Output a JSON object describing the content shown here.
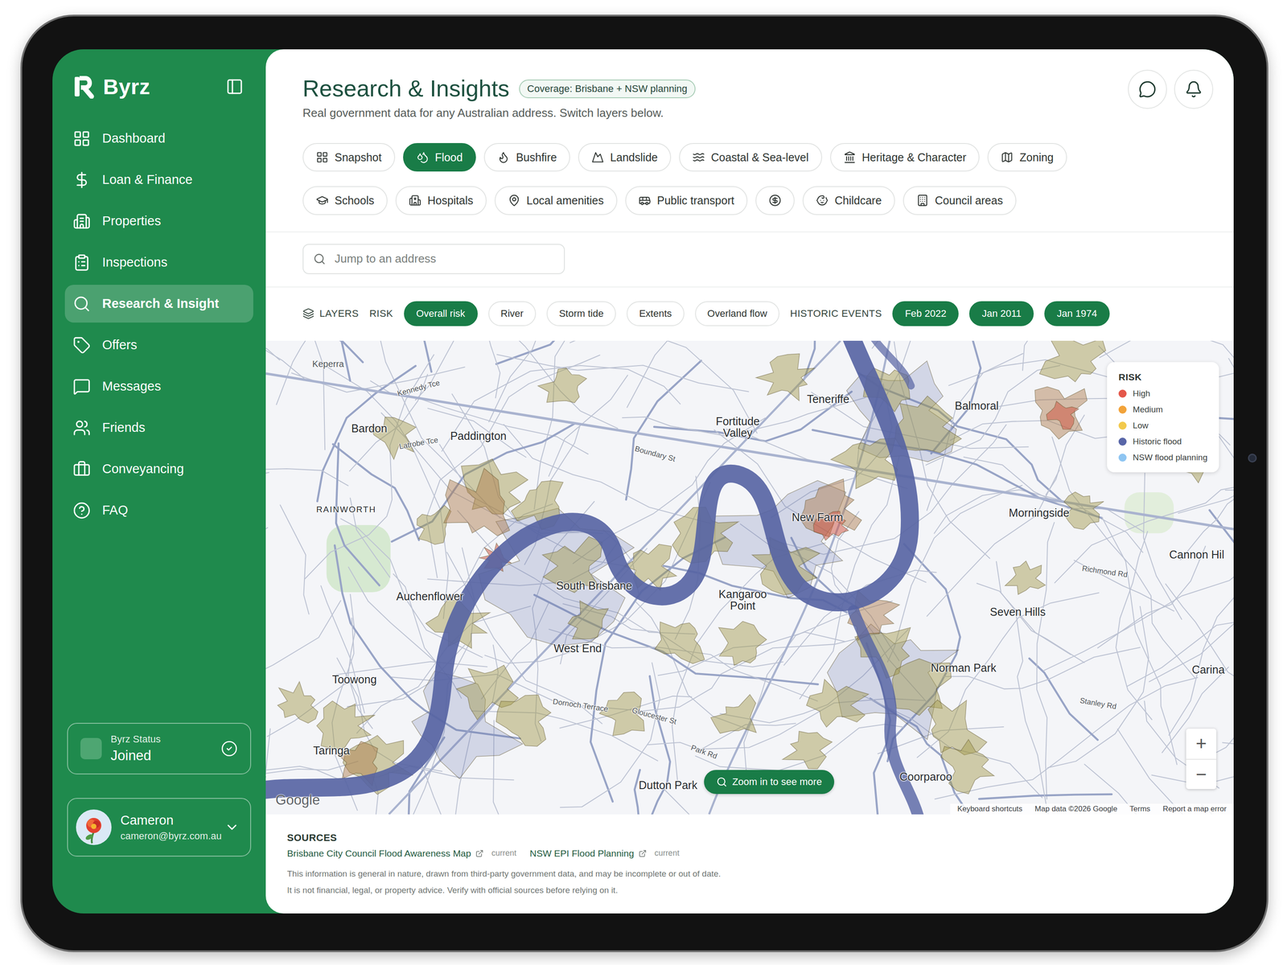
{
  "app": {
    "brand": "Byrz"
  },
  "sidebar": {
    "items": [
      {
        "label": "Dashboard",
        "selected": false
      },
      {
        "label": "Loan & Finance",
        "selected": false
      },
      {
        "label": "Properties",
        "selected": false
      },
      {
        "label": "Inspections",
        "selected": false
      },
      {
        "label": "Research & Insight",
        "selected": true
      },
      {
        "label": "Offers",
        "selected": false
      },
      {
        "label": "Messages",
        "selected": false
      },
      {
        "label": "Friends",
        "selected": false
      },
      {
        "label": "Conveyancing",
        "selected": false
      },
      {
        "label": "FAQ",
        "selected": false
      }
    ],
    "status": {
      "label": "Byrz Status",
      "value": "Joined"
    },
    "user": {
      "name": "Cameron",
      "email": "cameron@byrz.com.au"
    }
  },
  "header": {
    "title": "Research & Insights",
    "badge": "Coverage: Brisbane + NSW planning",
    "subtitle": "Real government data for any Australian address. Switch layers below."
  },
  "tab_rows": [
    [
      {
        "label": "Snapshot",
        "kind": "text",
        "selected": false
      },
      {
        "label": "Flood",
        "kind": "text",
        "selected": true
      },
      {
        "label": "Bushfire",
        "kind": "text",
        "selected": false
      },
      {
        "label": "Landslide",
        "kind": "text",
        "selected": false
      },
      {
        "label": "Coastal & Sea-level",
        "kind": "text",
        "selected": false
      },
      {
        "label": "Heritage & Character",
        "kind": "text",
        "selected": false
      },
      {
        "label": "Zoning",
        "kind": "text",
        "selected": false
      }
    ],
    [
      {
        "label": "Schools",
        "kind": "text",
        "selected": false
      },
      {
        "label": "Hospitals",
        "kind": "text",
        "selected": false
      },
      {
        "label": "Local amenities",
        "kind": "text",
        "selected": false
      },
      {
        "label": "Public transport",
        "kind": "text",
        "selected": false
      },
      {
        "kind": "icon",
        "selected": false
      },
      {
        "label": "Childcare",
        "kind": "text",
        "selected": false
      },
      {
        "label": "Council areas",
        "kind": "text",
        "selected": false
      }
    ]
  ],
  "search": {
    "placeholder": "Jump to an address"
  },
  "layers": {
    "label": "LAYERS",
    "groups": [
      {
        "label": "RISK",
        "chips": [
          {
            "label": "Overall risk",
            "selected": true
          },
          {
            "label": "River",
            "selected": false
          },
          {
            "label": "Storm tide",
            "selected": false
          },
          {
            "label": "Extents",
            "selected": false
          },
          {
            "label": "Overland flow",
            "selected": false
          }
        ]
      },
      {
        "label": "HISTORIC EVENTS",
        "chips": [
          {
            "label": "Feb 2022",
            "selected": true
          },
          {
            "label": "Jan 2011",
            "selected": true
          },
          {
            "label": "Jan 1974",
            "selected": true
          }
        ]
      }
    ]
  },
  "map": {
    "labels": [
      {
        "text": "Keperra",
        "kind": "minor"
      },
      {
        "text": "Kennedy Tce",
        "kind": "street"
      },
      {
        "text": "Bardon",
        "kind": "suburb"
      },
      {
        "text": "Paddington",
        "kind": "suburb"
      },
      {
        "text": "Latrobe Tce",
        "kind": "street"
      },
      {
        "text": "Teneriffe",
        "kind": "suburb"
      },
      {
        "text": "Fortitude Valley",
        "kind": "suburb"
      },
      {
        "text": "Balmoral",
        "kind": "suburb"
      },
      {
        "text": "Boundary St",
        "kind": "street"
      },
      {
        "text": "RAINWORTH",
        "kind": "district"
      },
      {
        "text": "New Farm",
        "kind": "suburb"
      },
      {
        "text": "Morningside",
        "kind": "suburb"
      },
      {
        "text": "Cannon Hil",
        "kind": "suburb"
      },
      {
        "text": "Richmond Rd",
        "kind": "street"
      },
      {
        "text": "Auchenflower",
        "kind": "suburb"
      },
      {
        "text": "South Brisbane",
        "kind": "suburb"
      },
      {
        "text": "Kangaroo Point",
        "kind": "suburb"
      },
      {
        "text": "Seven Hills",
        "kind": "suburb"
      },
      {
        "text": "West End",
        "kind": "suburb"
      },
      {
        "text": "Toowong",
        "kind": "suburb"
      },
      {
        "text": "Norman Park",
        "kind": "suburb"
      },
      {
        "text": "Carina",
        "kind": "suburb"
      },
      {
        "text": "Dornoch Terrace",
        "kind": "street"
      },
      {
        "text": "Gloucester St",
        "kind": "street"
      },
      {
        "text": "Stanley Rd",
        "kind": "street"
      },
      {
        "text": "Park Rd",
        "kind": "street"
      },
      {
        "text": "Taringa",
        "kind": "suburb"
      },
      {
        "text": "Dutton Park",
        "kind": "suburb"
      },
      {
        "text": "Coorparoo",
        "kind": "suburb"
      }
    ],
    "legend": {
      "title": "RISK",
      "items": [
        {
          "label": "High",
          "color": "#e4574a"
        },
        {
          "label": "Medium",
          "color": "#f2a33a"
        },
        {
          "label": "Low",
          "color": "#f2c94c"
        },
        {
          "label": "Historic flood",
          "color": "#5866a8"
        },
        {
          "label": "NSW flood planning",
          "color": "#8ec5f2"
        }
      ]
    },
    "zoom_hint": "Zoom in to see more",
    "zoom_in": "+",
    "zoom_out": "−",
    "google": "Google",
    "attribution": [
      "Keyboard shortcuts",
      "Map data ©2026 Google",
      "Terms",
      "Report a map error"
    ]
  },
  "sources": {
    "title": "SOURCES",
    "links": [
      {
        "label": "Brisbane City Council Flood Awareness Map",
        "status": "current"
      },
      {
        "label": "NSW EPI Flood Planning",
        "status": "current"
      }
    ],
    "disclaimer": [
      "This information is general in nature, drawn from third-party government data, and may be incomplete or out of date.",
      "It is not financial, legal, or property advice. Verify with official sources before relying on it."
    ]
  }
}
